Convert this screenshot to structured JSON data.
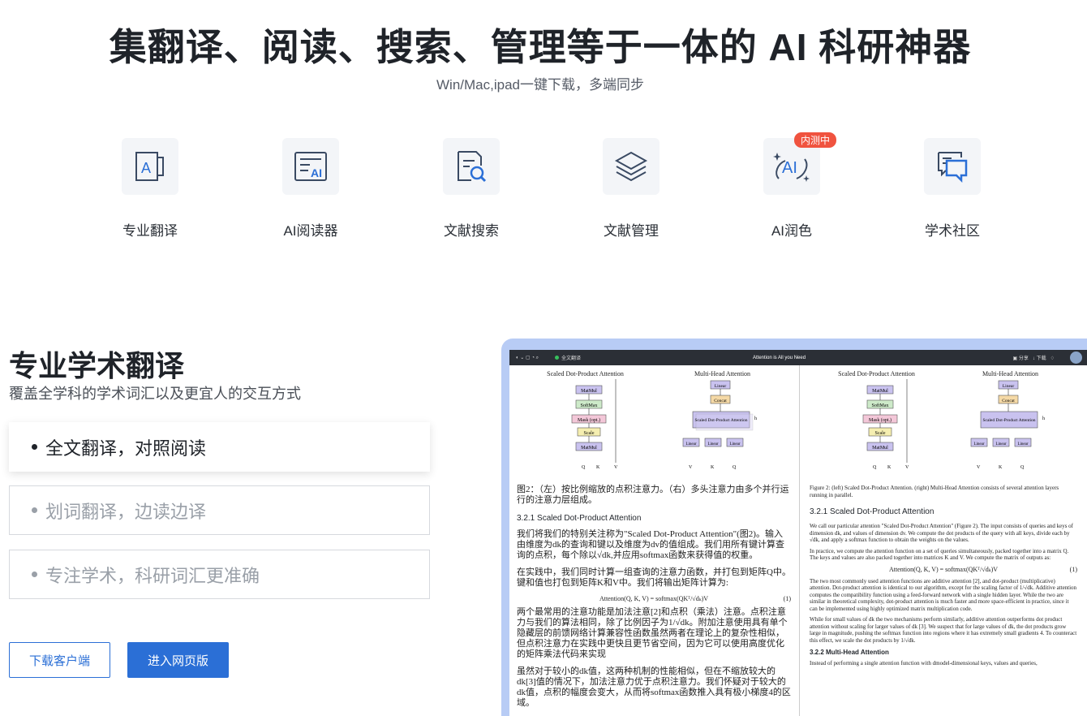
{
  "hero": {
    "title": "集翻译、阅读、搜索、管理等于一体的 AI 科研神器",
    "subtitle": "Win/Mac,ipad一键下载，多端同步"
  },
  "features": [
    {
      "label": "专业翻译",
      "icon": "translate-icon"
    },
    {
      "label": "AI阅读器",
      "icon": "ai-reader-icon"
    },
    {
      "label": "文献搜索",
      "icon": "document-search-icon"
    },
    {
      "label": "文献管理",
      "icon": "layers-icon"
    },
    {
      "label": "AI润色",
      "icon": "ai-polish-icon",
      "badge": "内测中"
    },
    {
      "label": "学术社区",
      "icon": "chat-bubbles-icon"
    }
  ],
  "section": {
    "title": "专业学术翻译",
    "subtitle": "覆盖全学科的学术词汇以及更宜人的交互方式",
    "options": [
      "全文翻译，对照阅读",
      "划词翻译，边读边译",
      "专注学术，科研词汇更准确"
    ]
  },
  "buttons": {
    "download": "下载客户端",
    "web": "进入网页版"
  },
  "colors": {
    "accent": "#2b6fd6",
    "badge": "#f0533f",
    "icon_blue": "#2b6fd6"
  },
  "preview": {
    "toolbar": {
      "mode": "全文翻译",
      "doc_title": "Attention is All you Need",
      "right_items": [
        "分享",
        "下载"
      ]
    },
    "left": {
      "diagram_titles": [
        "Scaled Dot-Product Attention",
        "Multi-Head Attention"
      ],
      "caption": "图2：（左）按比例缩放的点积注意力。（右）多头注意力由多个并行运行的注意力层组成。",
      "heading": "3.2.1   Scaled Dot-Product Attention",
      "paragraphs": [
        "我们将我们的特别关注称为\"Scaled Dot-Product Attention\"(图2)。输入由维度为dk的查询和键以及维度为dv的值组成。我们用所有键计算查询的点积，每个除以√dk,并应用softmax函数来获得值的权重。",
        "在实践中，我们同时计算一组查询的注意力函数，并打包到矩阵Q中。键和值也打包到矩阵K和V中。我们将输出矩阵计算为:",
        "两个最常用的注意功能是加法注意[2]和点积（乘法）注意。点积注意力与我们的算法相同，除了比例因子为1/√dk。附加注意使用具有单个隐藏层的前馈网络计算兼容性函数虽然两者在理论上的复杂性相似，但点积注意力在实践中更快且更节省空间，因为它可以使用高度优化的矩阵乘法代码来实现",
        "虽然对于较小的dk值，这两种机制的性能相似，但在不缩放较大的dk[3]值的情况下，加法注意力优于点积注意力。我们怀疑对于较大的dk值，点积的幅度会变大，从而将softmax函数推入具有极小梯度4的区域。"
      ],
      "equation": "Attention(Q, K, V) = softmax(QKᵀ/√dₖ)V",
      "eq_num": "(1)"
    },
    "right": {
      "diagram_titles": [
        "Scaled Dot-Product Attention",
        "Multi-Head Attention"
      ],
      "caption": "Figure 2: (left) Scaled Dot-Product Attention. (right) Multi-Head Attention consists of several attention layers running in parallel.",
      "heading": "3.2.1   Scaled Dot-Product Attention",
      "paragraphs": [
        "We call our particular attention \"Scaled Dot-Product Attention\" (Figure 2). The input consists of queries and keys of dimension dk, and values of dimension dv. We compute the dot products of the query with all keys, divide each by √dk, and apply a softmax function to obtain the weights on the values.",
        "In practice, we compute the attention function on a set of queries simultaneously, packed together into a matrix Q. The keys and values are also packed together into matrices K and V. We compute the matrix of outputs as:",
        "The two most commonly used attention functions are additive attention [2], and dot-product (multiplicative) attention. Dot-product attention is identical to our algorithm, except for the scaling factor of 1/√dk. Additive attention computes the compatibility function using a feed-forward network with a single hidden layer. While the two are similar in theoretical complexity, dot-product attention is much faster and more space-efficient in practice, since it can be implemented using highly optimized matrix multiplication code.",
        "While for small values of dk the two mechanisms perform similarly, additive attention outperforms dot product attention without scaling for larger values of dk [3]. We suspect that for large values of dk, the dot products grow large in magnitude, pushing the softmax function into regions where it has extremely small gradients 4. To counteract this effect, we scale the dot products by 1/√dk."
      ],
      "equation": "Attention(Q, K, V) = softmax(QKᵀ/√dₖ)V",
      "eq_num": "(1)",
      "heading2": "3.2.2   Multi-Head Attention",
      "tail": "Instead of performing a single attention function with dmodel-dimensional keys, values and queries,"
    },
    "diagram_blocks": {
      "scaled": [
        "MatMul",
        "SoftMax",
        "Mask (opt.)",
        "Scale",
        "MatMul"
      ],
      "scaled_inputs": [
        "Q",
        "K",
        "V"
      ],
      "multi": [
        "Linear",
        "Concat",
        "Scaled Dot-Product Attention",
        "Linear",
        "Linear",
        "Linear"
      ],
      "multi_inputs": [
        "V",
        "K",
        "Q"
      ],
      "multi_h": "h"
    }
  }
}
